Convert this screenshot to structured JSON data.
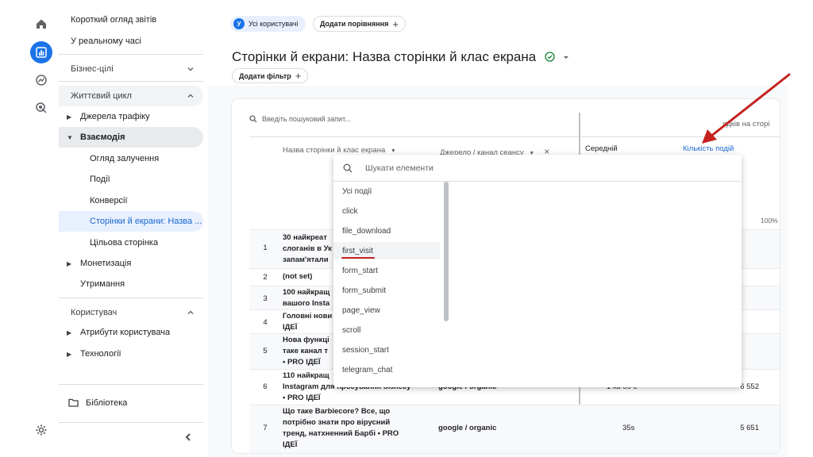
{
  "rail": {
    "icons": [
      "home-icon",
      "reports-icon",
      "explore-icon",
      "advertising-icon",
      "settings-icon"
    ]
  },
  "nav": {
    "items": [
      {
        "label": "Короткий огляд звітів"
      },
      {
        "label": "У реальному часі"
      },
      {
        "label": "Бізнес-цілі"
      },
      {
        "label": "Життєвий цикл"
      },
      {
        "label": "Джерела трафіку"
      },
      {
        "label": "Взаємодія"
      },
      {
        "label": "Огляд залучення"
      },
      {
        "label": "Події"
      },
      {
        "label": "Конверсії"
      },
      {
        "label": "Сторінки й екрани: Назва ..."
      },
      {
        "label": "Цільова сторінка"
      },
      {
        "label": "Монетизація"
      },
      {
        "label": "Утримання"
      },
      {
        "label": "Користувач"
      },
      {
        "label": "Атрибути користувача"
      },
      {
        "label": "Технології"
      }
    ],
    "library": "Бібліотека"
  },
  "header": {
    "segment_avatar": "У",
    "segment_label": "Усі користувачі",
    "compare_label": "Додати порівняння",
    "title": "Сторінки й екрани: Назва сторінки й клас екрана",
    "filter_label": "Додати фільтр"
  },
  "table": {
    "search_placeholder": "Введіть пошуковий запит...",
    "rows_per_page_partial": "ядків на сторі",
    "columns": [
      "Назва сторінки й клас екрана",
      "Джерело / канал сеансу",
      "Середній",
      "Кількість подій"
    ],
    "percent_partial": "100%",
    "rows": [
      {
        "idx": "1",
        "name": "30 найкреат\nслоганів в Ук\nзапам'ятали",
        "src": "",
        "avg": "",
        "cnt": ""
      },
      {
        "idx": "2",
        "name": "(not set)",
        "src": "",
        "avg": "",
        "cnt": ""
      },
      {
        "idx": "3",
        "name": "100 найкращ\nвашого Insta",
        "src": "",
        "avg": "",
        "cnt": ""
      },
      {
        "idx": "4",
        "name": "Головні нови\nІДЕЇ",
        "src": "",
        "avg": "",
        "cnt": ""
      },
      {
        "idx": "5",
        "name": "Нова функці\nтаке канал т\n• PRO ІДЕЇ",
        "src": "",
        "avg": "",
        "cnt": ""
      },
      {
        "idx": "6",
        "name": "110 найкращ\nInstagram для просування бізнесу\n• PRO ІДЕЇ",
        "src": "google / organic",
        "avg": "1 хв 09 с",
        "cnt": "6 552"
      },
      {
        "idx": "7",
        "name": "Що таке Barbiecore? Все, що\nпотрібно знати про вірусний\nтренд, натхненний Барбі • PRO\nІДЕЇ",
        "src": "google / organic",
        "avg": "35s",
        "cnt": "5 651"
      }
    ]
  },
  "dropdown": {
    "search_placeholder": "Шукати елементи",
    "items": [
      "Усі події",
      "click",
      "file_download",
      "first_visit",
      "form_start",
      "form_submit",
      "page_view",
      "scroll",
      "session_start",
      "telegram_chat"
    ]
  },
  "colors": {
    "accent": "#1a73e8",
    "arrow": "#c5221f"
  }
}
